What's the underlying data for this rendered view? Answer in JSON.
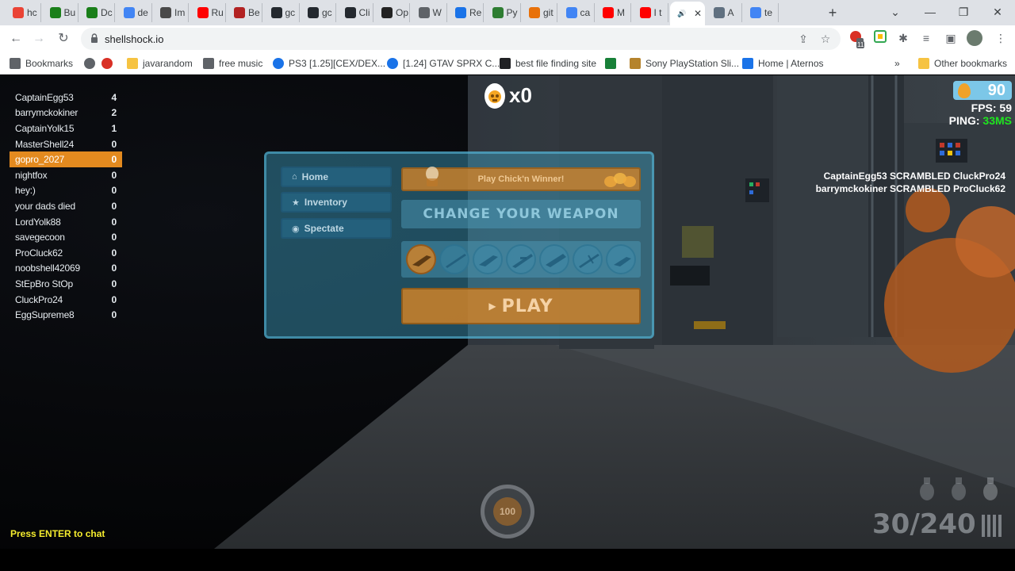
{
  "browser": {
    "tabs": [
      {
        "label": "hc",
        "color": "#ea4335"
      },
      {
        "label": "Bu",
        "color": "#1a7f1a"
      },
      {
        "label": "Dc",
        "color": "#1a7f1a"
      },
      {
        "label": "de",
        "color": "#4285f4"
      },
      {
        "label": "Im",
        "color": "#4a4a4a"
      },
      {
        "label": "Ru",
        "color": "#ff0000"
      },
      {
        "label": "Be",
        "color": "#b22222"
      },
      {
        "label": "gc",
        "color": "#24292f"
      },
      {
        "label": "gc",
        "color": "#24292f"
      },
      {
        "label": "Cli",
        "color": "#24292f"
      },
      {
        "label": "Op",
        "color": "#222222"
      },
      {
        "label": "W",
        "color": "#5f6368"
      },
      {
        "label": "Re",
        "color": "#1a73e8"
      },
      {
        "label": "Py",
        "color": "#2e7d32"
      },
      {
        "label": "git",
        "color": "#e8710a"
      },
      {
        "label": "ca",
        "color": "#4285f4"
      },
      {
        "label": "M",
        "color": "#ff0000"
      },
      {
        "label": "I t",
        "color": "#ff0000"
      },
      {
        "label": "",
        "color": "#ffffff",
        "active": true,
        "close": "✕",
        "speaker": "🔊"
      },
      {
        "label": "A",
        "color": "#607080"
      },
      {
        "label": "te",
        "color": "#4285f4"
      }
    ],
    "new_tab": "+",
    "window_controls": {
      "dropdown": "⌄",
      "minimize": "—",
      "restore": "❐",
      "close": "✕"
    },
    "url": "shellshock.io",
    "nav": {
      "back": "←",
      "forward": "→",
      "reload": "↻"
    },
    "extension_badge": "11",
    "bookmarks": [
      {
        "label": "Bookmarks",
        "icon": "star-icon"
      },
      {
        "label": "",
        "icon": "chrome-icon"
      },
      {
        "label": "",
        "icon": "heart-icon"
      },
      {
        "label": "javarandom",
        "icon": "folder-icon"
      },
      {
        "label": "free music",
        "icon": "music-icon"
      },
      {
        "label": "PS3 [1.25][CEX/DEX...",
        "icon": "globe-icon"
      },
      {
        "label": "[1.24] GTAV SPRX C...",
        "icon": "globe-icon"
      },
      {
        "label": "best file finding site",
        "icon": "search-icon"
      },
      {
        "label": "",
        "icon": "app-icon"
      },
      {
        "label": "Sony PlayStation Sli...",
        "icon": "bag-icon"
      },
      {
        "label": "Home | Aternos",
        "icon": "grid-icon"
      }
    ],
    "bookmarks_overflow": "»",
    "other_bookmarks": "Other bookmarks"
  },
  "game": {
    "scoreboard": [
      {
        "name": "CaptainEgg53",
        "score": "4"
      },
      {
        "name": "barrymckokiner",
        "score": "2"
      },
      {
        "name": "CaptainYolk15",
        "score": "1"
      },
      {
        "name": "MasterShell24",
        "score": "0"
      },
      {
        "name": "gopro_2027",
        "score": "0",
        "me": true
      },
      {
        "name": "nightfox",
        "score": "0"
      },
      {
        "name": "hey:)",
        "score": "0"
      },
      {
        "name": "your dads died",
        "score": "0"
      },
      {
        "name": "LordYolk88",
        "score": "0"
      },
      {
        "name": "savegecoon",
        "score": "0"
      },
      {
        "name": "ProCluck62",
        "score": "0"
      },
      {
        "name": "noobshell42069",
        "score": "0"
      },
      {
        "name": "StEpBro StOp",
        "score": "0"
      },
      {
        "name": "CluckPro24",
        "score": "0"
      },
      {
        "name": "EggSupreme8",
        "score": "0"
      }
    ],
    "kills": "x0",
    "eggs": "90",
    "fps_label": "FPS:",
    "fps": "59",
    "ping_label": "PING:",
    "ping": "33MS",
    "killfeed": [
      "CaptainEgg53 SCRAMBLED CluckPro24",
      "barrymckokiner SCRAMBLED ProCluck62"
    ],
    "menu": {
      "home": "Home",
      "inventory": "Inventory",
      "spectate": "Spectate",
      "chicknwin": "Play Chick'n Winner!",
      "change_weapon": "CHANGE YOUR WEAPON",
      "play": "PLAY"
    },
    "chat_hint": "Press ENTER to chat",
    "health": "100",
    "ammo": "30/240"
  }
}
